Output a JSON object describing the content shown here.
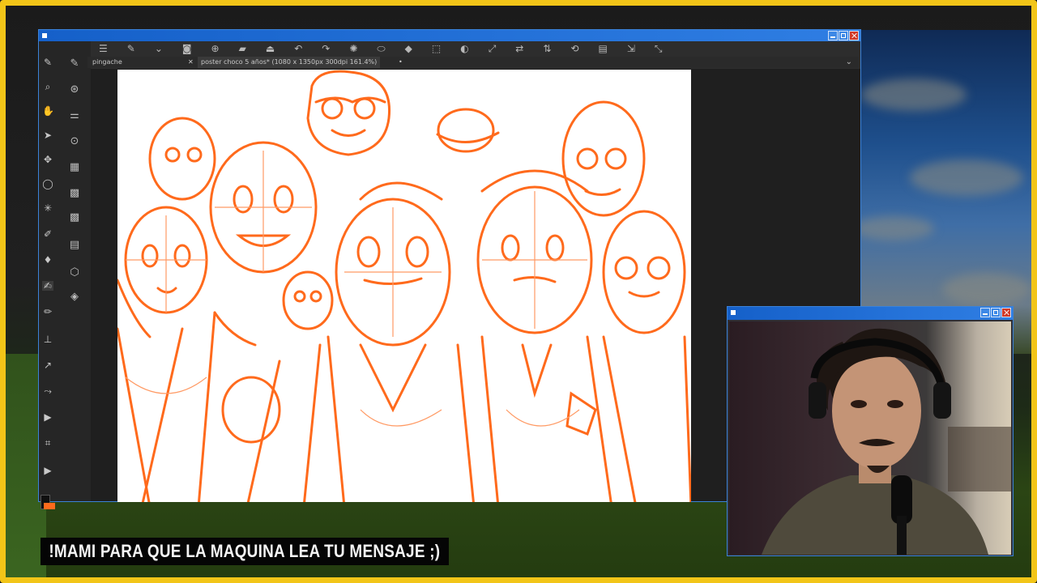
{
  "app": {
    "tabs": [
      {
        "label": "pingache"
      },
      {
        "label": "poster choco 5 años* (1080 x 1350px 300dpi 161.4%)"
      }
    ],
    "accent_color": "#ff6a1c",
    "frame_color": "#f2c518",
    "titlebar_color": "#1f6fdb"
  },
  "toolbar_icons": [
    "menu-icon",
    "brush-preset-icon",
    "chevron-down-icon",
    "screenshot-icon",
    "new-icon",
    "open-icon",
    "save-icon",
    "chevron-down-icon",
    "undo-icon",
    "redo-icon",
    "brush-settings-icon",
    "eraser-icon",
    "fill-icon",
    "opacity-icon",
    "select-icon",
    "transform-icon",
    "mirror-h-icon",
    "mirror-v-icon",
    "wrap-icon",
    "layer-icon",
    "export-icon",
    "fit-icon"
  ],
  "caption": {
    "text": "!MAMI PARA QUE LA MAQUINA LEA TU MENSAJE ;)"
  },
  "webcam": {
    "title": ""
  }
}
